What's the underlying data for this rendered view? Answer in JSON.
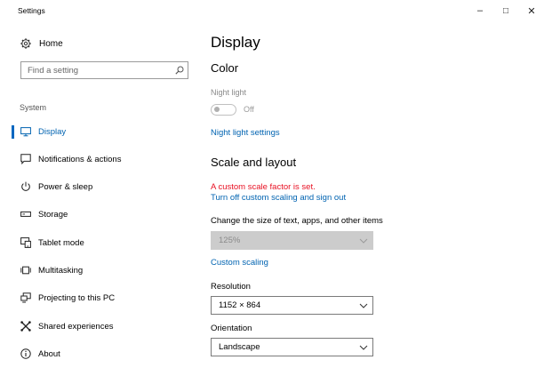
{
  "window": {
    "title": "Settings",
    "minimize_glyph": "–",
    "maximize_glyph": "□",
    "close_glyph": "✕"
  },
  "sidebar": {
    "home_label": "Home",
    "search_placeholder": "Find a setting",
    "section_label": "System",
    "items": [
      {
        "label": "Display",
        "icon": "monitor-icon",
        "active": true
      },
      {
        "label": "Notifications & actions",
        "icon": "notification-icon",
        "active": false
      },
      {
        "label": "Power & sleep",
        "icon": "power-icon",
        "active": false
      },
      {
        "label": "Storage",
        "icon": "storage-drive-icon",
        "active": false
      },
      {
        "label": "Tablet mode",
        "icon": "tablet-mode-icon",
        "active": false
      },
      {
        "label": "Multitasking",
        "icon": "multitasking-icon",
        "active": false
      },
      {
        "label": "Projecting to this PC",
        "icon": "projecting-icon",
        "active": false
      },
      {
        "label": "Shared experiences",
        "icon": "shared-experiences-icon",
        "active": false
      },
      {
        "label": "About",
        "icon": "info-icon",
        "active": false
      }
    ]
  },
  "main": {
    "page_title": "Display",
    "color": {
      "heading": "Color",
      "night_light_label": "Night light",
      "night_light_state": "Off",
      "night_light_settings_link": "Night light settings"
    },
    "scale": {
      "heading": "Scale and layout",
      "warning": "A custom scale factor is set.",
      "turn_off_link": "Turn off custom scaling and sign out",
      "size_label": "Change the size of text, apps, and other items",
      "size_value": "125%",
      "custom_scaling_link": "Custom scaling",
      "resolution_label": "Resolution",
      "resolution_value": "1152 × 864",
      "orientation_label": "Orientation",
      "orientation_value": "Landscape"
    }
  },
  "colors": {
    "accent": "#0063b1",
    "warning": "#e81123",
    "disabled_dropdown": "#cccccc"
  }
}
